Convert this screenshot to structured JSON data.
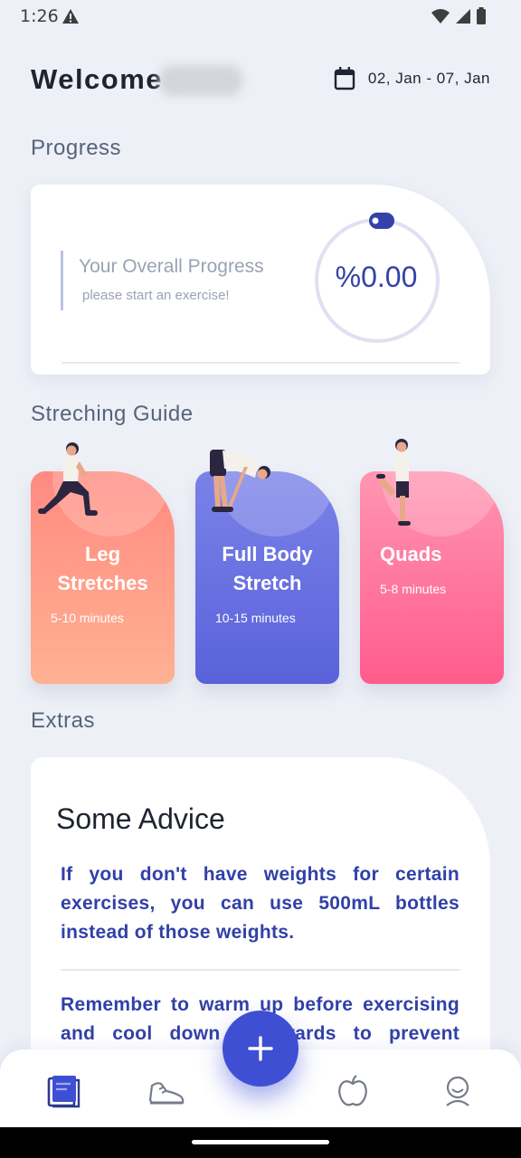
{
  "status_bar": {
    "time": "1:26",
    "warning_icon": "warning-icon",
    "icons": [
      "wifi-icon",
      "signal-icon",
      "battery-icon"
    ]
  },
  "header": {
    "welcome": "Welcome",
    "calendar_icon": "calendar-icon",
    "date_range": "02, Jan - 07, Jan"
  },
  "progress": {
    "section_title": "Progress",
    "title": "Your Overall Progress",
    "subtitle": "please start an exercise!",
    "value": "%0.00",
    "fraction": 0.0
  },
  "guide": {
    "section_title": "Streching Guide",
    "cards": [
      {
        "title": "Leg Stretches",
        "title_line1": "Leg",
        "title_line2": "Stretches",
        "time": "5-10 minutes"
      },
      {
        "title": "Full Body Stretch",
        "title_line1": "Full Body",
        "title_line2": "Stretch",
        "time": "10-15 minutes"
      },
      {
        "title": "Quads",
        "time": "5-8 minutes"
      }
    ]
  },
  "extras": {
    "section_title": "Extras",
    "advice_title": "Some Advice",
    "advice_1": "If you don't have weights for certain exercises, you can use 500mL bottles instead of those weights.",
    "advice_2": "Remember to warm up before exercising and cool down afterwards to prevent injuries."
  },
  "bottom_nav": {
    "items": [
      "journal-icon",
      "shoe-icon",
      "apple-icon",
      "profile-icon"
    ],
    "active": "journal-icon",
    "fab_icon": "plus-icon"
  },
  "colors": {
    "accent": "#3f4fd4",
    "text_blue": "#3140a8",
    "leg": "#ff8a80",
    "full_body": "#6a72e2",
    "quads": "#ff6f9a"
  }
}
